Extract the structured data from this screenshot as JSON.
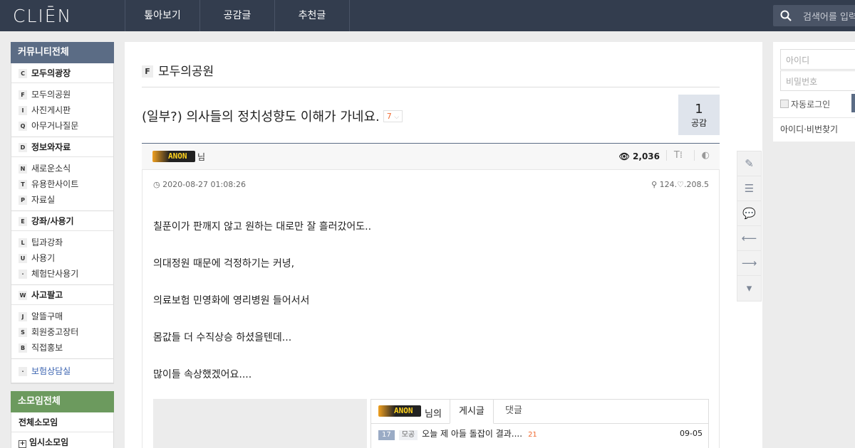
{
  "header": {
    "logo": "CLIĒN",
    "nav": [
      "톺아보기",
      "공감글",
      "추천글"
    ],
    "search_placeholder": "검색어를 입력"
  },
  "sidebar": {
    "top_label": "커뮤니티전체",
    "groups": [
      {
        "icon": "C",
        "label": "모두의광장",
        "items": [
          {
            "icon": "F",
            "label": "모두의공원"
          },
          {
            "icon": "I",
            "label": "사진게시판"
          },
          {
            "icon": "Q",
            "label": "아무거나질문"
          }
        ]
      },
      {
        "icon": "D",
        "label": "정보와자료",
        "items": [
          {
            "icon": "N",
            "label": "새로운소식"
          },
          {
            "icon": "T",
            "label": "유용한사이트"
          },
          {
            "icon": "P",
            "label": "자료실"
          }
        ]
      },
      {
        "icon": "E",
        "label": "강좌/사용기",
        "items": [
          {
            "icon": "L",
            "label": "팁과강좌"
          },
          {
            "icon": "U",
            "label": "사용기"
          },
          {
            "icon": "·",
            "label": "체험단사용기"
          }
        ]
      },
      {
        "icon": "W",
        "label": "사고팔고",
        "items": [
          {
            "icon": "J",
            "label": "알뜰구매"
          },
          {
            "icon": "S",
            "label": "회원중고장터"
          },
          {
            "icon": "B",
            "label": "직접홍보"
          }
        ]
      }
    ],
    "extra_item": {
      "icon": "·",
      "label": "보험상담실"
    },
    "sub_label": "소모임전체",
    "sub_items": [
      "전체소모임",
      "임시소모임"
    ]
  },
  "board": {
    "badge": "F",
    "name": "모두의공원"
  },
  "post": {
    "title": "(일부?) 의사들의 정치성향도 이해가 가네요.",
    "comment_count": "7",
    "sympathy_count": "1",
    "sympathy_label": "공감",
    "avatar_text": "ANON",
    "author_suffix": "님",
    "views": "2,036",
    "date": "2020-08-27 01:08:26",
    "ip": "124.♡.208.5",
    "content": [
      "칠푼이가 판깨지 않고 원하는 대로만 잘 흘러갔어도..",
      "의대정원 때문에 걱정하기는 커녕,",
      "의료보험 민영화에 영리병원 들어서서",
      "몸값들 더 수직상승 하셨을텐데...",
      "많이들 속상했겠어요...."
    ]
  },
  "profile": {
    "avatar_text": "ANON",
    "suffix": "님의",
    "tab_posts": "게시글",
    "tab_comments": "댓글",
    "row": {
      "num": "17",
      "cat": "모공",
      "title": "오늘 제 아들 돌잡이 결과....",
      "count": "21",
      "date": "09-05"
    }
  },
  "login": {
    "id_placeholder": "아이디",
    "pw_placeholder": "비밀번호",
    "auto_login": "자동로그인",
    "find": "아이디·비번찾기"
  },
  "colors": {
    "header": "#333d4e",
    "side_cat": "#5b6c85",
    "side_green": "#6c9a5e",
    "accent": "#f06a30"
  }
}
